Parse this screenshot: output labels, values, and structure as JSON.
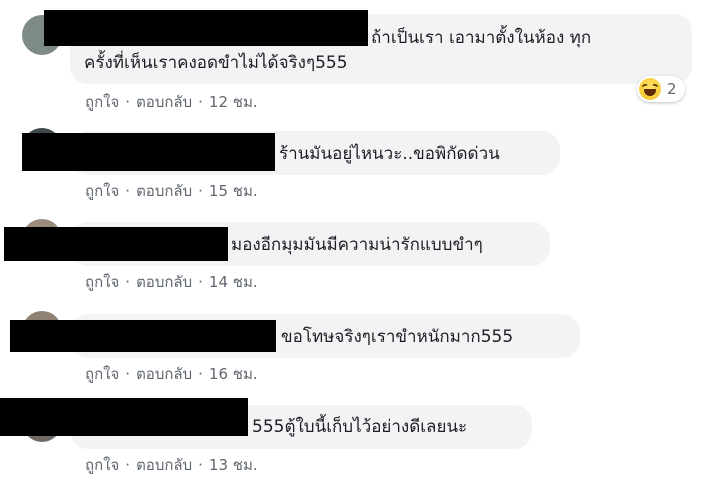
{
  "comments": [
    {
      "lines": [
        "ถ้าเป็นเรา เอามาตั้งในห้อง ทุก",
        "ครั้งที่เห็นเราคงอดขำไม่ได้จริงๆ555"
      ],
      "actions": {
        "like": "ถูกใจ",
        "reply": "ตอบกลับ",
        "time": "12 ชม."
      },
      "reaction": {
        "icon": "haha-icon",
        "count": "2"
      }
    },
    {
      "lines": [
        "ร้านมันอยู่ไหนวะ..ขอพิกัดด่วน"
      ],
      "actions": {
        "like": "ถูกใจ",
        "reply": "ตอบกลับ",
        "time": "15 ชม."
      }
    },
    {
      "lines": [
        "มองอีกมุมมันมีความน่ารักแบบขำๆ"
      ],
      "actions": {
        "like": "ถูกใจ",
        "reply": "ตอบกลับ",
        "time": "14 ชม."
      }
    },
    {
      "lines": [
        "ขอโทษจริงๆเราขำหนักมาก555"
      ],
      "actions": {
        "like": "ถูกใจ",
        "reply": "ตอบกลับ",
        "time": "16 ชม."
      }
    },
    {
      "lines": [
        "555ตู้ใบนี้เก็บไว้อย่างดีเลยนะ"
      ],
      "actions": {
        "like": "ถูกใจ",
        "reply": "ตอบกลับ",
        "time": "13 ชม."
      }
    }
  ],
  "separator": "·",
  "colors": {
    "bubble": "#f2f3f5",
    "text": "#1c1e21",
    "meta": "#606770",
    "redaction": "#000000"
  }
}
